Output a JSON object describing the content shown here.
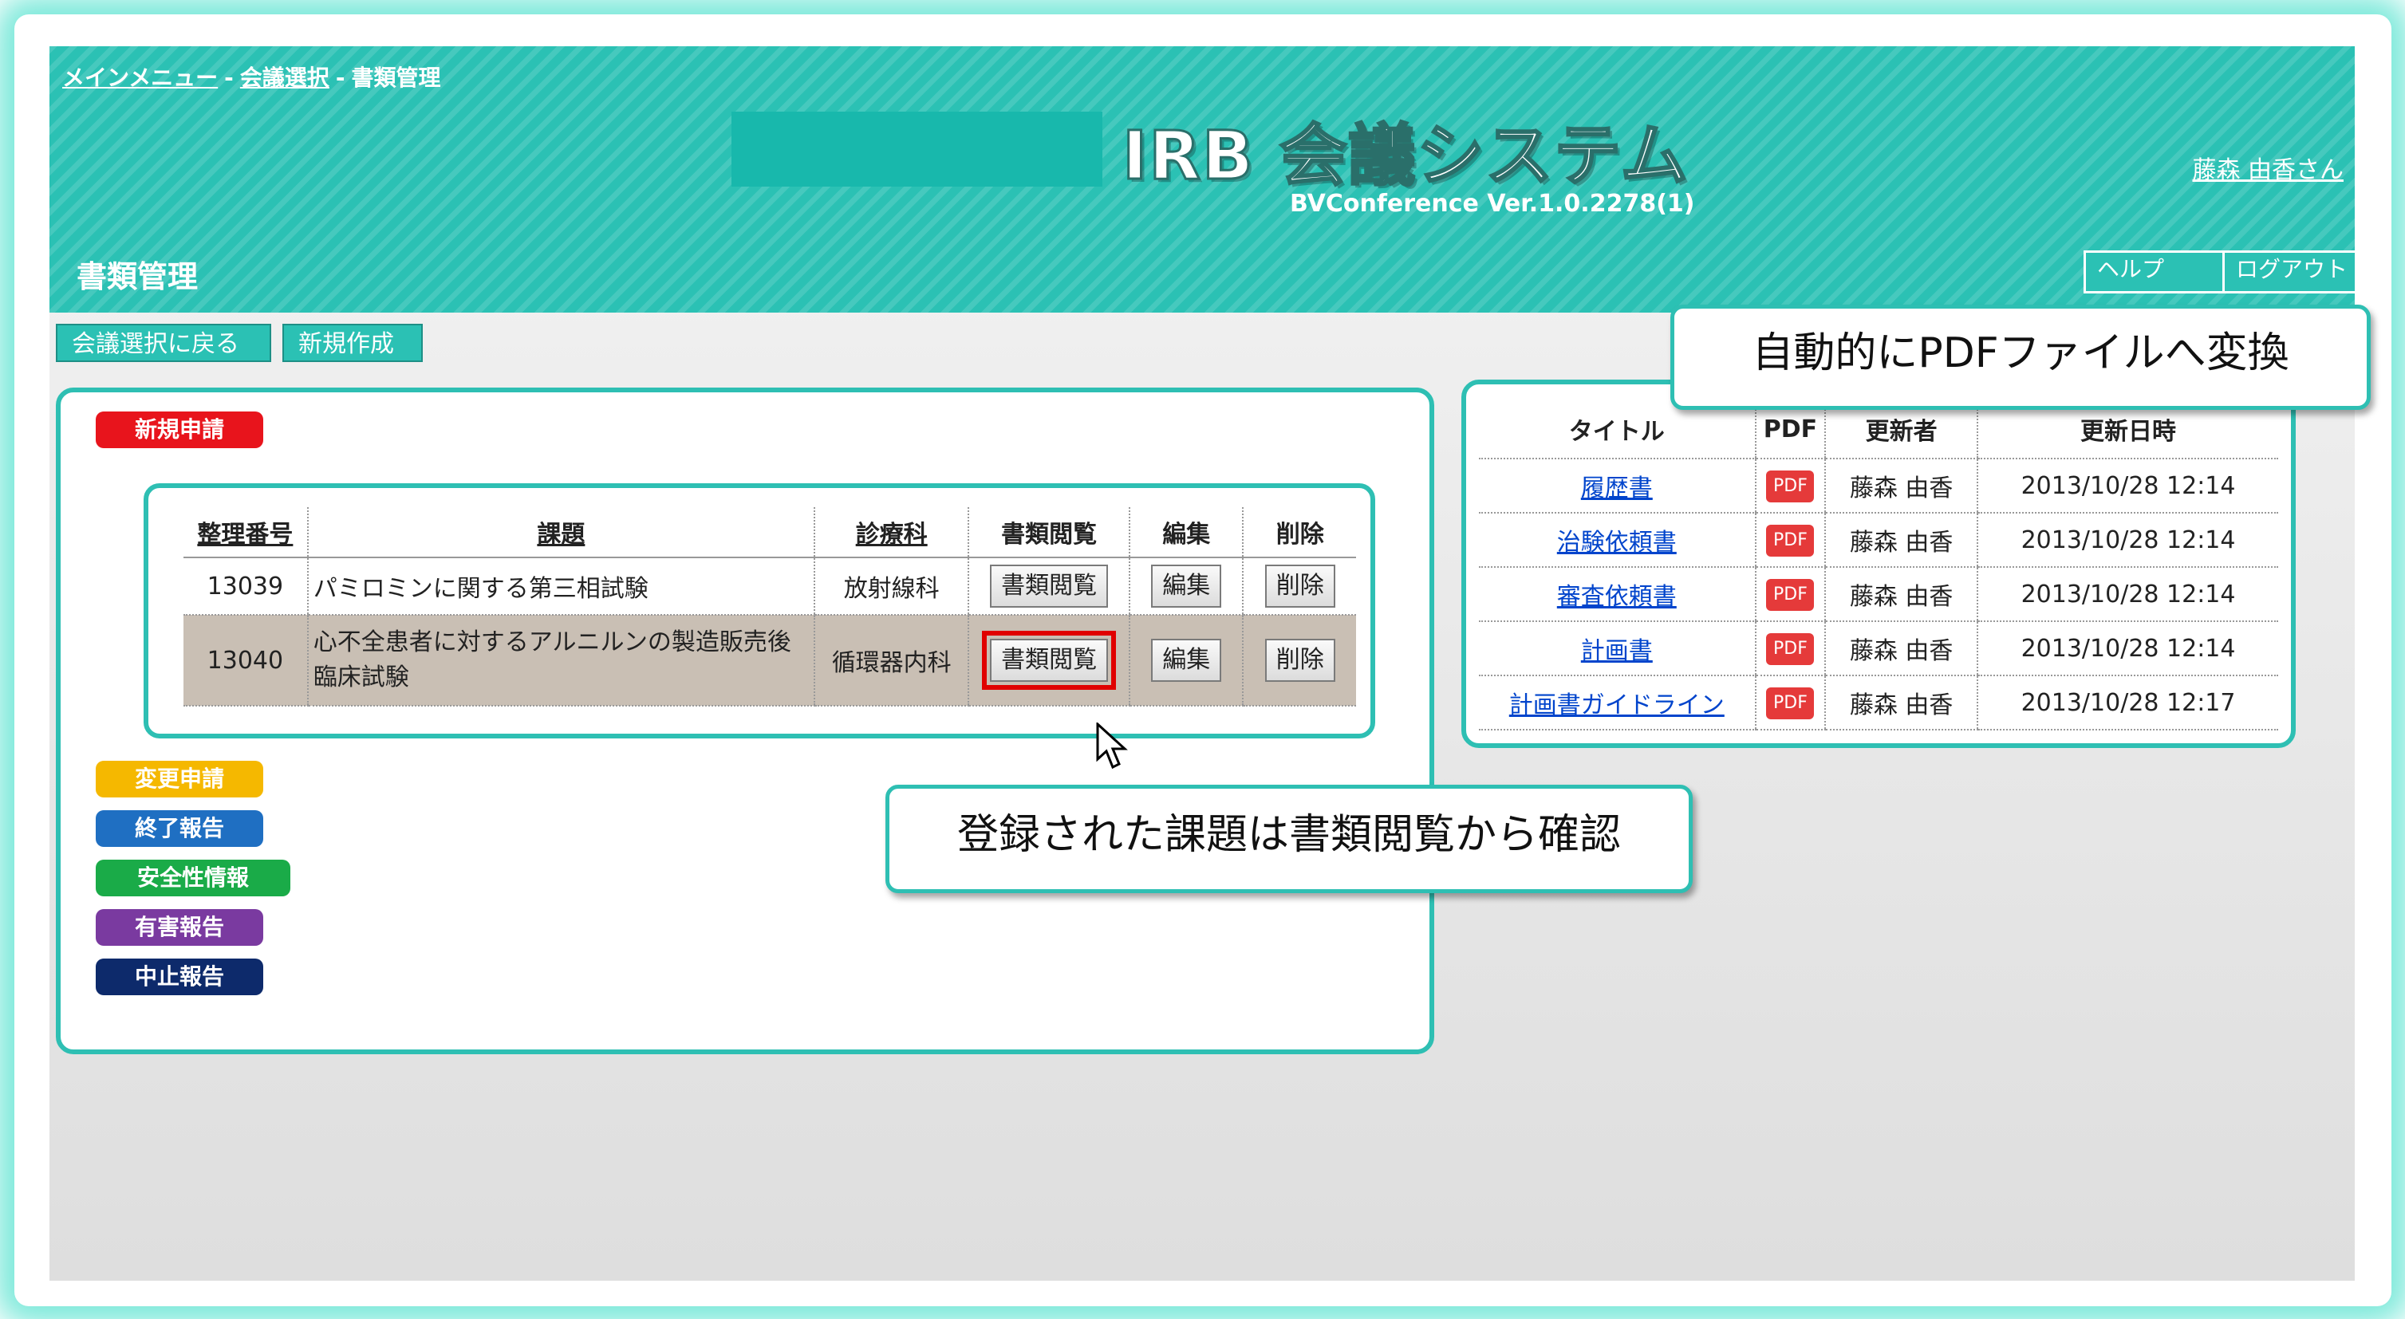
{
  "breadcrumb": {
    "items": [
      "メインメニュー",
      "会議選択",
      "書類管理"
    ],
    "separator": "-"
  },
  "header": {
    "app_title": "IRB 会議システム",
    "version": "BVConference Ver.1.0.2278(1)",
    "user": "藤森 由香さん",
    "page_title": "書類管理",
    "help_label": "ヘルプ",
    "logout_label": "ログアウト"
  },
  "toolbar": {
    "back_label": "会議選択に戻る",
    "new_label": "新規作成"
  },
  "categories": {
    "new": "新規申請",
    "change": "変更申請",
    "end": "終了報告",
    "safety": "安全性情報",
    "harm": "有害報告",
    "stop": "中止報告"
  },
  "main_table": {
    "headers": [
      "整理番号",
      "課題",
      "診療科",
      "書類閲覧",
      "編集",
      "削除"
    ],
    "rows": [
      {
        "id": "13039",
        "title": "パミロミンに関する第三相試験",
        "dept": "放射線科",
        "view": "書類閲覧",
        "edit": "編集",
        "delete": "削除"
      },
      {
        "id": "13040",
        "title": "心不全患者に対するアルニルンの製造販売後臨床試験",
        "dept": "循環器内科",
        "view": "書類閲覧",
        "edit": "編集",
        "delete": "削除"
      }
    ]
  },
  "doc_table": {
    "headers": [
      "タイトル",
      "PDF",
      "更新者",
      "更新日時"
    ],
    "rows": [
      {
        "title": "履歴書",
        "pdf": "PDF",
        "updater": "藤森 由香",
        "date": "2013/10/28 12:14"
      },
      {
        "title": "治験依頼書",
        "pdf": "PDF",
        "updater": "藤森 由香",
        "date": "2013/10/28 12:14"
      },
      {
        "title": "審査依頼書",
        "pdf": "PDF",
        "updater": "藤森 由香",
        "date": "2013/10/28 12:14"
      },
      {
        "title": "計画書",
        "pdf": "PDF",
        "updater": "藤森 由香",
        "date": "2013/10/28 12:14"
      },
      {
        "title": "計画書ガイドライン",
        "pdf": "PDF",
        "updater": "藤森 由香",
        "date": "2013/10/28 12:17"
      }
    ]
  },
  "callouts": {
    "pdf_note": "自動的にPDFファイルへ変換",
    "view_note": "登録された課題は書類閲覧から確認"
  },
  "colors": {
    "header_teal": "#2bc1b4",
    "new_red": "#e8141c",
    "change_yellow": "#f5b800",
    "end_blue": "#1f6fc2",
    "safety_green": "#1aab48",
    "harm_purple": "#7a3aa0",
    "stop_navy": "#0d2a6b",
    "highlight_red": "#e00000"
  }
}
